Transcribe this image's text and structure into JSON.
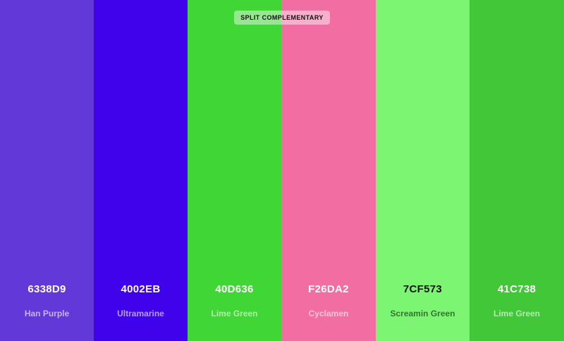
{
  "scheme": {
    "label": "SPLIT COMPLEMENTARY"
  },
  "colors": [
    {
      "hex": "6338D9",
      "name": "Han Purple",
      "color": "#6338D9",
      "text_tone": "light"
    },
    {
      "hex": "4002EB",
      "name": "Ultramarine",
      "color": "#4002EB",
      "text_tone": "light"
    },
    {
      "hex": "40D636",
      "name": "Lime Green",
      "color": "#40D636",
      "text_tone": "light"
    },
    {
      "hex": "F26DA2",
      "name": "Cyclamen",
      "color": "#F26DA2",
      "text_tone": "light"
    },
    {
      "hex": "7CF573",
      "name": "Screamin Green",
      "color": "#7CF573",
      "text_tone": "dark"
    },
    {
      "hex": "41C738",
      "name": "Lime Green",
      "color": "#41C738",
      "text_tone": "light"
    }
  ]
}
